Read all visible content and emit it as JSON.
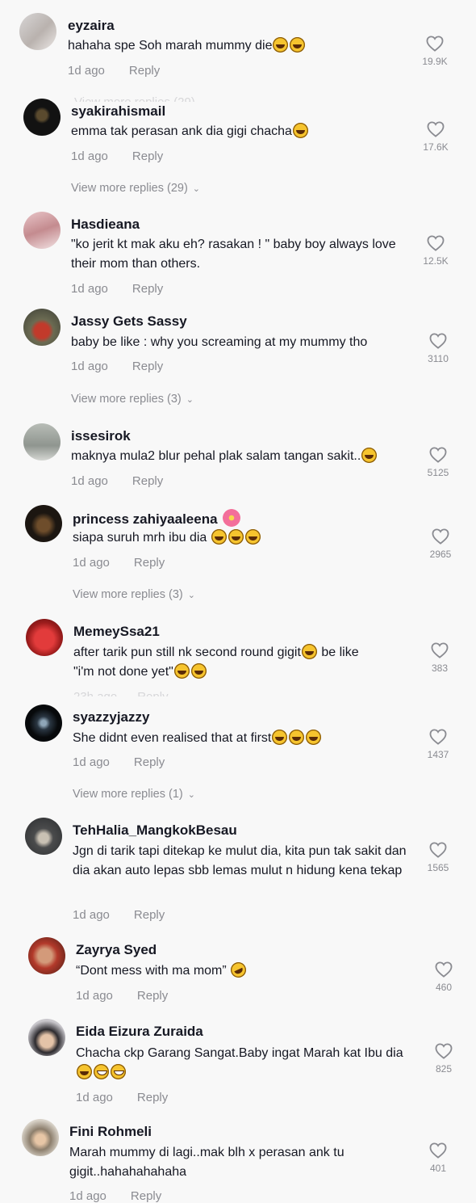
{
  "comments": [
    {
      "username": "eyzaira",
      "text": "hahaha spe Soh marah mummy die",
      "emojis": [
        "laugh",
        "laugh"
      ],
      "time": "1d ago",
      "reply": "Reply",
      "likes": "19.9K"
    },
    {
      "username": "syakirahismail",
      "text": "emma tak perasan ank dia gigi chacha",
      "emojis": [
        "laugh"
      ],
      "time": "1d ago",
      "reply": "Reply",
      "likes": "17.6K",
      "more": "View more replies (29)"
    },
    {
      "username": "Hasdieana",
      "text": "\"ko jerit kt mak aku eh? rasakan ! \" baby boy always love their mom than others.",
      "emojis": [],
      "time": "1d ago",
      "reply": "Reply",
      "likes": "12.5K"
    },
    {
      "username": "Jassy Gets Sassy",
      "text": "baby be like : why you screaming at my mummy tho",
      "emojis": [],
      "time": "1d ago",
      "reply": "Reply",
      "likes": "3110",
      "more": "View more replies (3)"
    },
    {
      "username": "issesirok",
      "text": "maknya mula2 blur pehal plak salam tangan sakit..",
      "emojis": [
        "laugh"
      ],
      "time": "1d ago",
      "reply": "Reply",
      "likes": "5125"
    },
    {
      "username": "princess zahiyaaleena",
      "text": "siapa suruh mrh ibu dia ",
      "emojis": [
        "laugh",
        "laugh",
        "laugh"
      ],
      "time": "1d ago",
      "reply": "Reply",
      "likes": "2965",
      "more": "View more replies (3)"
    },
    {
      "username": "MemeySsa21",
      "text_a": "after tarik pun still nk second round gigit",
      "text_b": " be like",
      "text_c": "\"i'm not done yet\"",
      "time": "",
      "reply": "",
      "likes": "383"
    },
    {
      "username": "syazzyjazzy",
      "text": "She didnt even realised that at first",
      "emojis": [
        "laugh",
        "laugh",
        "laugh"
      ],
      "time": "1d ago",
      "reply": "Reply",
      "likes": "1437",
      "more": "View more replies (1)"
    },
    {
      "username": "TehHalia_MangkokBesau",
      "text": "Jgn di tarik tapi ditekap ke mulut dia, kita pun tak sakit dan dia akan auto lepas sbb lemas mulut n hidung kena tekap",
      "emojis": [],
      "time": "1d ago",
      "reply": "Reply",
      "likes": "1565"
    },
    {
      "username": "Zayrya Syed",
      "text": "“Dont mess with ma mom” ",
      "emojis": [
        "roll"
      ],
      "time": "1d ago",
      "reply": "Reply",
      "likes": "460"
    },
    {
      "username": "Eida Eizura Zuraida",
      "text": "Chacha ckp Garang Sangat.Baby ingat Marah kat Ibu dia",
      "emojis": [
        "laugh",
        "grin",
        "grin"
      ],
      "time": "1d ago",
      "reply": "Reply",
      "likes": "825"
    },
    {
      "username": "Fini Rohmeli",
      "text": "Marah mummy di lagi..mak blh x perasan ank tu gigit..hahahahahaha",
      "emojis": [],
      "time": "1d ago",
      "reply": "Reply",
      "likes": "401"
    }
  ],
  "colors": {
    "background": "#f8f8f8",
    "muted": "#8a8b91",
    "text": "#161823"
  },
  "icons": {
    "like": "heart-outline-icon",
    "expand": "chevron-down-icon"
  }
}
